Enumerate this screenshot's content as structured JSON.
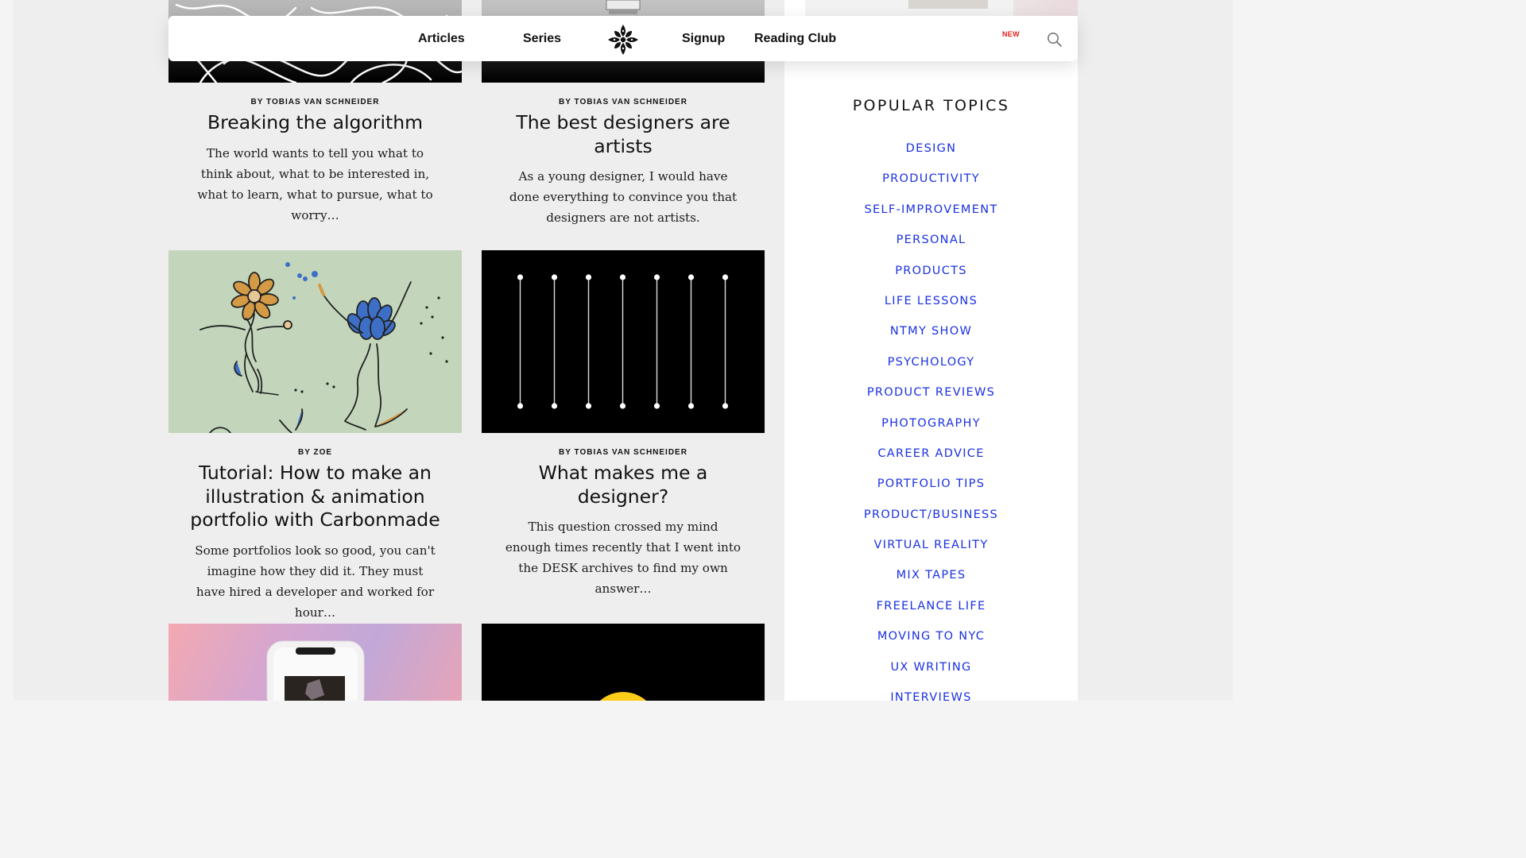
{
  "nav": {
    "articles": "Articles",
    "series": "Series",
    "signup": "Signup",
    "reading_club": "Reading Club",
    "new_badge": "NEW",
    "logo_icon": "ornamental-fleuron-icon",
    "search_icon": "search-icon"
  },
  "articles": [
    {
      "byline": "BY TOBIAS VAN SCHNEIDER",
      "title": "Breaking the algorithm",
      "excerpt": "The world wants to tell you what to think about, what to be interested in, what to learn, what to pursue, what to worry…"
    },
    {
      "byline": "BY TOBIAS VAN SCHNEIDER",
      "title": "The best designers are artists",
      "excerpt": "As a young designer, I would have done everything to convince you that designers are not artists."
    },
    {
      "byline": "BY ZOE",
      "title": "Tutorial: How to make an illustration & animation portfolio with Carbonmade",
      "excerpt": "Some portfolios look so good, you can't imagine how they did it. They must have hired a developer and worked for hour…"
    },
    {
      "byline": "BY TOBIAS VAN SCHNEIDER",
      "title": "What makes me a designer?",
      "excerpt": "This question crossed my mind enough times recently that I went into the DESK archives to find my own answer…"
    }
  ],
  "sidebar": {
    "title": "POPULAR TOPICS",
    "topics": [
      "DESIGN",
      "PRODUCTIVITY",
      "SELF-IMPROVEMENT",
      "PERSONAL",
      "PRODUCTS",
      "LIFE LESSONS",
      "NTMY SHOW",
      "PSYCHOLOGY",
      "PRODUCT REVIEWS",
      "PHOTOGRAPHY",
      "CAREER ADVICE",
      "PORTFOLIO TIPS",
      "PRODUCT/BUSINESS",
      "VIRTUAL REALITY",
      "MIX TAPES",
      "FREELANCE LIFE",
      "MOVING TO NYC",
      "UX WRITING",
      "INTERVIEWS"
    ]
  },
  "colors": {
    "topic_link": "#1a31e0",
    "new_badge": "#e0201a",
    "illustration_bg": "#c3d6bb",
    "slider_bg": "#000000"
  }
}
